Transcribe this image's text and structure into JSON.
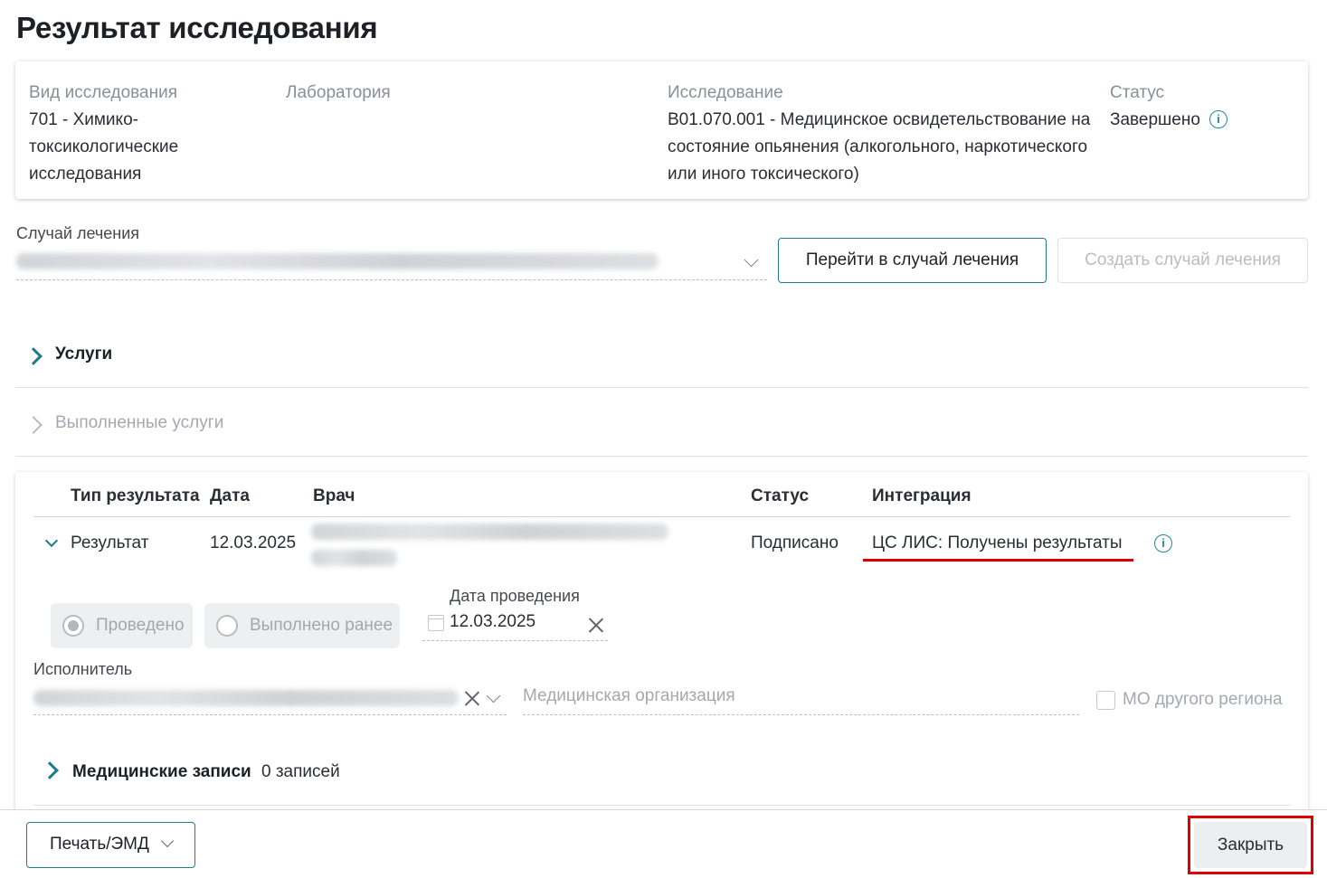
{
  "page_title": "Результат исследования",
  "info": {
    "type_label": "Вид исследования",
    "type_value": "701 - Химико-токсикологические исследования",
    "lab_label": "Лаборатория",
    "study_label": "Исследование",
    "study_value": "B01.070.001 - Медицинское освидетельствование на состояние опьянения (алкогольного, наркотического или иного токсического)",
    "status_label": "Статус",
    "status_value": "Завершено"
  },
  "case": {
    "label": "Случай лечения",
    "goto_button": "Перейти в случай лечения",
    "create_button": "Создать случай лечения"
  },
  "sections": {
    "services": "Услуги",
    "completed_services": "Выполненные услуги"
  },
  "results_table": {
    "headers": [
      "Тип результата",
      "Дата",
      "Врач",
      "Статус",
      "Интеграция"
    ],
    "row": {
      "type": "Результат",
      "date": "12.03.2025",
      "status": "Подписано",
      "integration": "ЦС ЛИС: Получены результаты"
    }
  },
  "form": {
    "radio_done": "Проведено",
    "radio_done_earlier": "Выполнено ранее",
    "date_label": "Дата проведения",
    "date_value": "12.03.2025",
    "executor_label": "Исполнитель",
    "med_org_placeholder": "Медицинская организация",
    "other_region_label": "МО другого региона"
  },
  "records": {
    "title": "Медицинские записи",
    "count": "0 записей"
  },
  "footer": {
    "print_button": "Печать/ЭМД",
    "close_button": "Закрыть"
  }
}
